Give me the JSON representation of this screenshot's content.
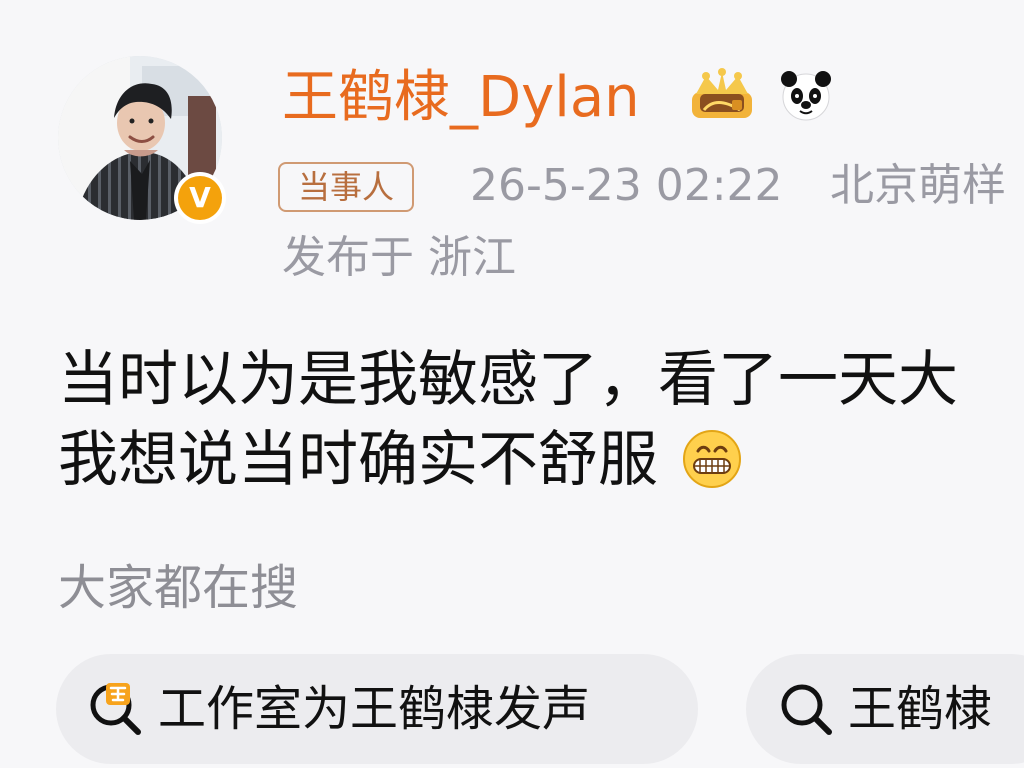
{
  "post": {
    "username": "王鹤棣_Dylan",
    "role_tag": "当事人",
    "time": "26-5-23 02:22",
    "source": "北京萌样",
    "location": "发布于 浙江",
    "body_line_1": "当时以为是我敏感了，看了一天大",
    "body_line_2": "我想说当时确实不舒服"
  },
  "search": {
    "title": "大家都在搜",
    "chips": [
      {
        "label": "工作室为王鹤棣发声",
        "icon": "hot-search-icon"
      },
      {
        "label": "王鹤棣",
        "icon": "search-icon"
      }
    ]
  },
  "colors": {
    "username": "#e86b1f",
    "role_tag_border": "#d09a73",
    "role_tag_text": "#b86f3f",
    "meta_text": "#9a9aa3",
    "badge": "#f4a20c",
    "chip_background": "#ececef"
  },
  "icons": {
    "verified_badge": "verified-v-badge",
    "crown": "crown-icon",
    "panda": "panda-icon",
    "emoji": "grin-emoji"
  },
  "badges": {
    "verified_text": "V"
  }
}
